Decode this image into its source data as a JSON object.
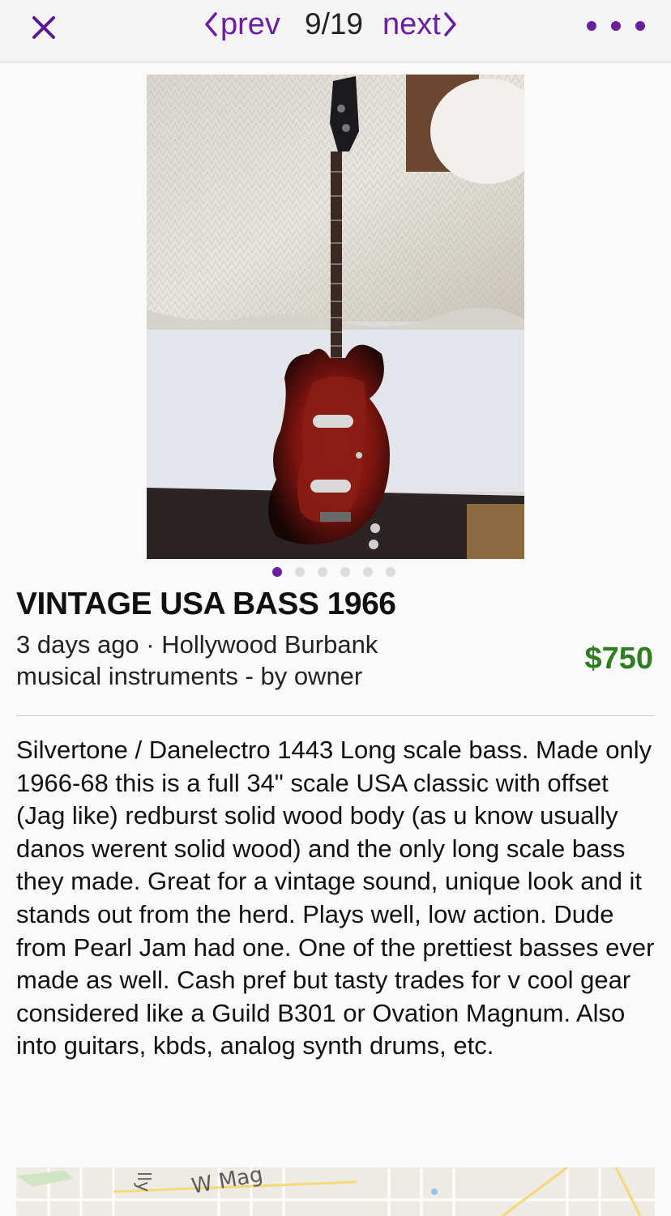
{
  "header": {
    "close_icon": "close-icon",
    "prev_label": "prev",
    "counter": "9/19",
    "next_label": "next",
    "more_icon": "more-dots-icon",
    "accent_color": "#6b1fa0"
  },
  "gallery": {
    "image_description_icon": "photo-image",
    "dot_count": 6,
    "active_index": 0
  },
  "listing": {
    "title": "VINTAGE USA BASS 1966",
    "posted": "3 days ago · Hollywood Burbank",
    "category": "musical instruments - by owner",
    "price": "$750",
    "price_color": "#2e7d1e",
    "description": "Silvertone / Danelectro 1443 Long scale bass. Made only 1966-68 this is a full 34\" scale USA classic with offset (Jag like) redburst solid wood body (as u know usually danos werent solid wood) and the only long scale bass they made. Great for a vintage sound, unique look and it stands out from the herd. Plays well, low action. Dude from Pearl Jam had one. One of the prettiest basses ever made as well. Cash pref but tasty trades for v cool gear considered like a Guild B301 or Ovation Magnum. Also into guitars, kbds, analog synth drums, etc."
  },
  "map": {
    "street_label": "W Mag",
    "side_label": "lly"
  }
}
